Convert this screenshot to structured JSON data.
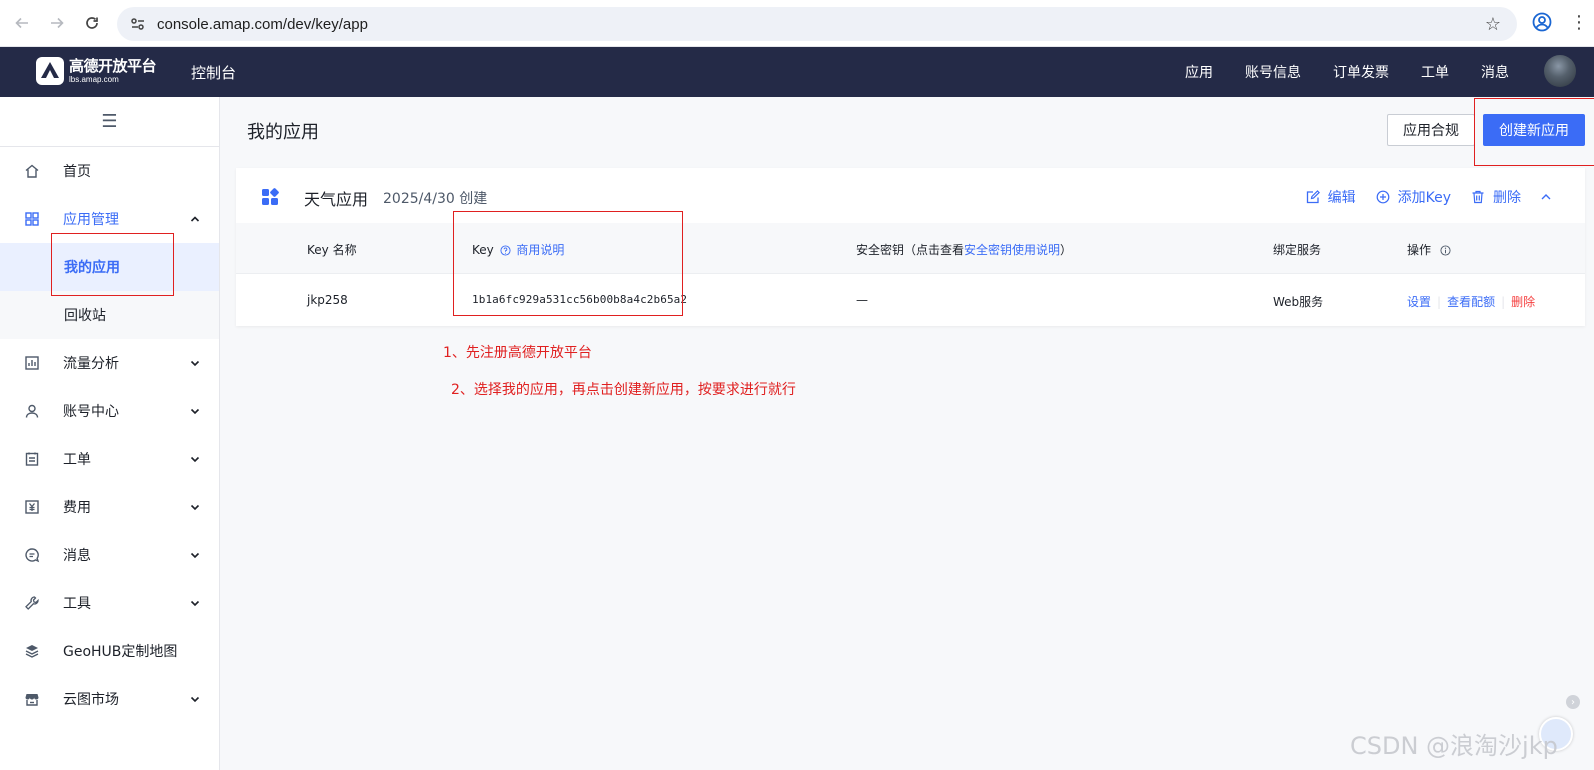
{
  "browser": {
    "url": "console.amap.com/dev/key/app"
  },
  "header": {
    "logo_main": "高德开放平台",
    "logo_sub": "lbs.amap.com",
    "console_title": "控制台",
    "nav": [
      "应用",
      "账号信息",
      "订单发票",
      "工单",
      "消息"
    ]
  },
  "sidebar": {
    "items": [
      {
        "label": "首页",
        "icon": "home-icon"
      },
      {
        "label": "应用管理",
        "icon": "grid-icon"
      },
      {
        "label": "流量分析",
        "icon": "chart-icon"
      },
      {
        "label": "账号中心",
        "icon": "user-icon"
      },
      {
        "label": "工单",
        "icon": "ticket-icon"
      },
      {
        "label": "费用",
        "icon": "yen-icon"
      },
      {
        "label": "消息",
        "icon": "message-icon"
      },
      {
        "label": "工具",
        "icon": "wrench-icon"
      },
      {
        "label": "GeoHUB定制地图",
        "icon": "layers-icon"
      },
      {
        "label": "云图市场",
        "icon": "store-icon"
      }
    ],
    "sub_items": [
      "我的应用",
      "回收站"
    ]
  },
  "main": {
    "page_title": "我的应用",
    "compliance_button": "应用合规",
    "create_button": "创建新应用",
    "app": {
      "name": "天气应用",
      "created": "2025/4/30 创建",
      "actions": {
        "edit": "编辑",
        "add_key": "添加Key",
        "delete": "删除"
      }
    },
    "table": {
      "headers": {
        "key_name": "Key 名称",
        "key": "Key",
        "key_note": "商用说明",
        "secret_prefix": "安全密钥（点击查看",
        "secret_link": "安全密钥使用说明",
        "secret_suffix": "）",
        "service": "绑定服务",
        "ops": "操作"
      },
      "row": {
        "key_name": "jkp258",
        "key": "1b1a6fc929a531cc56b00b8a4c2b65a2",
        "secret": "—",
        "service": "Web服务",
        "op_settings": "设置",
        "op_quota": "查看配额",
        "op_delete": "删除"
      }
    }
  },
  "annotations": {
    "step1": "1、先注册高德开放平台",
    "step2": "2、选择我的应用，再点击创建新应用，按要求进行就行"
  },
  "watermark": "CSDN @浪淘沙jkp",
  "colors": {
    "accent": "#3b6cf6",
    "header_bg": "#242a47",
    "annotation": "#e02020",
    "danger": "#f53f3f"
  }
}
